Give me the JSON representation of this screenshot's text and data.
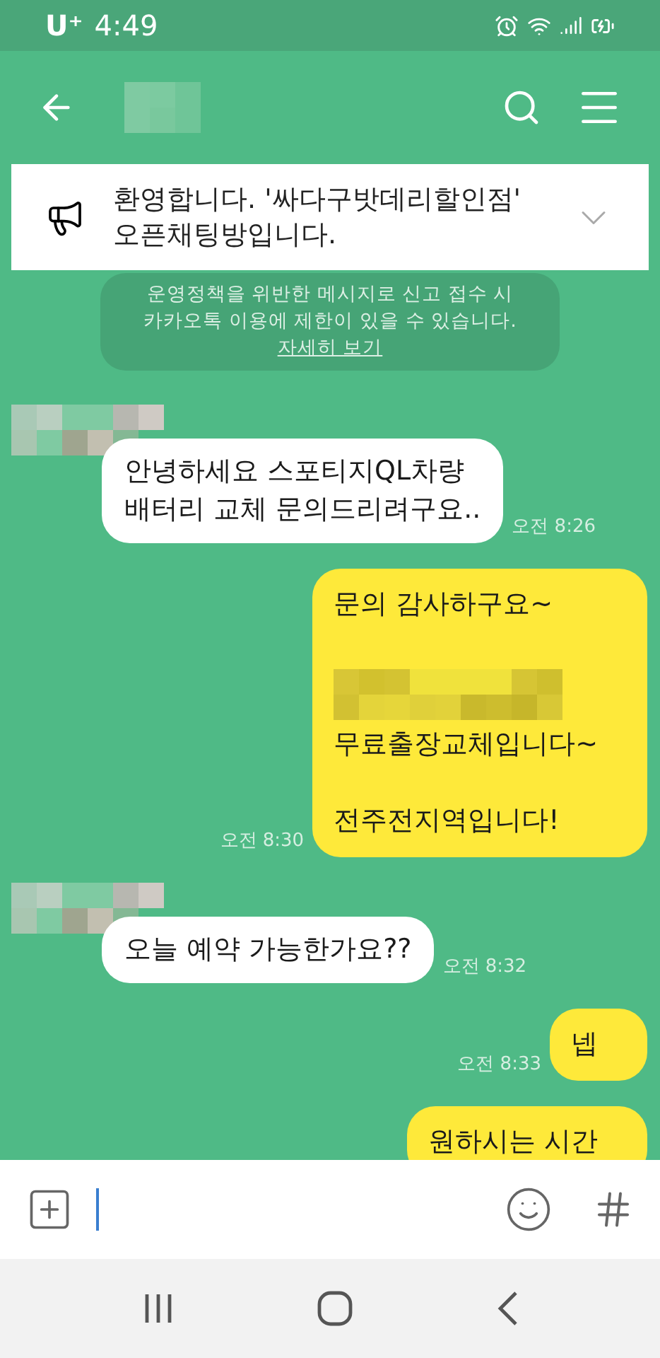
{
  "status_bar": {
    "carrier": "U⁺",
    "time": "4:49"
  },
  "notice": {
    "lines": [
      "환영합니다. '싸다구밧데리할인점'",
      "오픈채팅방입니다."
    ],
    "expanded": false
  },
  "policy": {
    "lines": [
      "운영정책을 위반한 메시지로 신고 접수 시",
      "카카오톡 이용에 제한이 있을 수 있습니다."
    ],
    "link": "자세히 보기"
  },
  "messages": [
    {
      "kind": "received",
      "parts": [
        {
          "kind": "text",
          "text": "안녕하세요 스포티지QL차량"
        },
        {
          "kind": "text",
          "text": "배터리 교체 문의드리려구요.."
        }
      ],
      "time": "오전 8:26"
    },
    {
      "kind": "sent",
      "parts": [
        {
          "kind": "text",
          "text": "문의 감사하구요~"
        },
        {
          "kind": "gap"
        },
        {
          "kind": "redacted"
        },
        {
          "kind": "text",
          "text": "무료출장교체입니다~"
        },
        {
          "kind": "gap"
        },
        {
          "kind": "text",
          "text": "전주전지역입니다!"
        }
      ],
      "time": "오전 8:30"
    },
    {
      "kind": "received",
      "parts": [
        {
          "kind": "text",
          "text": "오늘 예약 가능한가요??"
        }
      ],
      "time": "오전 8:32"
    },
    {
      "kind": "sent",
      "parts": [
        {
          "kind": "text",
          "text": "넵"
        }
      ],
      "time": "오전 8:33"
    },
    {
      "kind": "sent",
      "parts": [
        {
          "kind": "text",
          "text": "원하시는 시간"
        }
      ]
    }
  ]
}
